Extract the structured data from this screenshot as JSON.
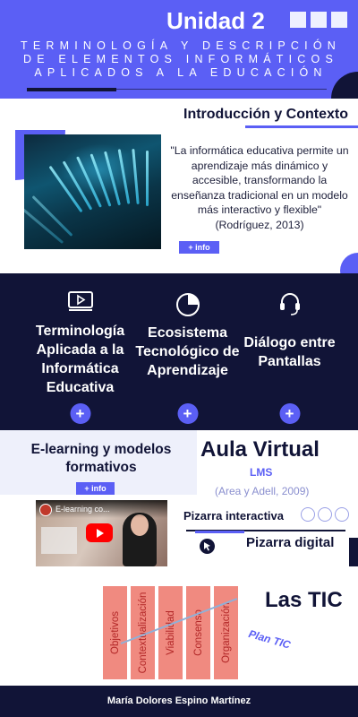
{
  "header": {
    "unit_title": "Unidad 2",
    "subtitle": "Terminología y descripción de elementos informáticos aplicados a la educación"
  },
  "intro": {
    "title": "Introducción y Contexto",
    "quote": "\"La informática educativa permite un aprendizaje más dinámico y accesible, transformando la enseñanza tradicional en un modelo más interactivo y flexible\" (Rodríguez, 2013)",
    "info_label": "+ info"
  },
  "columns": [
    {
      "icon": "video-player-icon",
      "label": "Terminología Aplicada a la Informática Educativa",
      "plus": "+"
    },
    {
      "icon": "pie-chart-icon",
      "label": "Ecosistema Tecnológico de Aprendizaje",
      "plus": "+"
    },
    {
      "icon": "headset-icon",
      "label": "Diálogo entre Pantallas",
      "plus": "+"
    }
  ],
  "elearning": {
    "title": "E-learning y modelos formativos",
    "info_label": "+ info"
  },
  "aula": {
    "title": "Aula Virtual",
    "lms": "LMS",
    "citation": "(Area y Adell, 2009)"
  },
  "video": {
    "title": "E-learning co..."
  },
  "pizarra": {
    "interactiva": "Pizarra interactiva",
    "digital": "Pizarra digital"
  },
  "tic": {
    "title": "Las TIC",
    "plan": "Plan TIC",
    "pillars": [
      "Objetivos",
      "Contextualización",
      "Viabilidad",
      "Consenso",
      "Organización"
    ]
  },
  "footer": {
    "author": "María Dolores Espino Martínez"
  },
  "colors": {
    "accent": "#5b5ff5",
    "dark": "#111437",
    "pillar": "#f08a80"
  }
}
